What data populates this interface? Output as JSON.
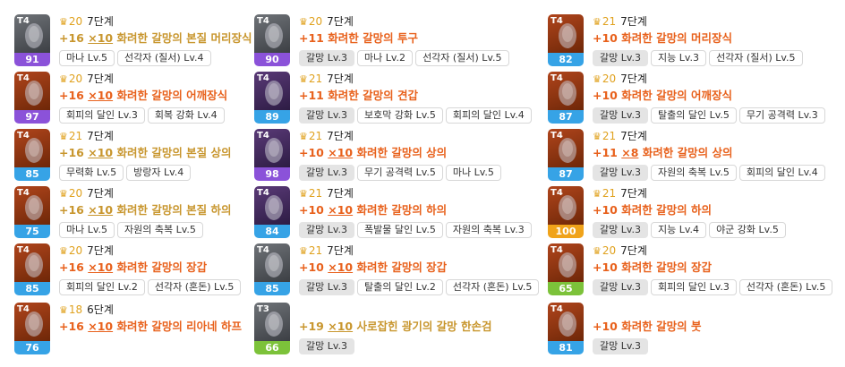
{
  "items": [
    {
      "tier": "T4",
      "level": "91",
      "quality": "20",
      "stage": "7단계",
      "plus": "+16",
      "mult": "×10",
      "name": " 화려한 갈망의 본질 머리장식",
      "badges": [
        "마나 Lv.5",
        "선각자 (질서) Lv.4"
      ]
    },
    {
      "tier": "T4",
      "level": "90",
      "quality": "20",
      "stage": "7단계",
      "plus": "+11",
      "mult": "",
      "name": " 화려한 갈망의 투구",
      "badges": [
        "갈망 Lv.3",
        "마나 Lv.2",
        "선각자 (질서) Lv.5"
      ]
    },
    {
      "tier": "T4",
      "level": "82",
      "quality": "21",
      "stage": "7단계",
      "plus": "+10",
      "mult": "",
      "name": " 화려한 갈망의 머리장식",
      "badges": [
        "갈망 Lv.3",
        "지능 Lv.3",
        "선각자 (질서) Lv.5"
      ]
    },
    {
      "tier": "T4",
      "level": "97",
      "quality": "20",
      "stage": "7단계",
      "plus": "+16",
      "mult": "×10",
      "name": " 화려한 갈망의 어깨장식",
      "badges": [
        "회피의 달인 Lv.3",
        "회복 강화 Lv.4"
      ]
    },
    {
      "tier": "T4",
      "level": "89",
      "quality": "21",
      "stage": "7단계",
      "plus": "+11",
      "mult": "",
      "name": " 화려한 갈망의 견갑",
      "badges": [
        "갈망 Lv.3",
        "보호막 강화 Lv.5",
        "회피의 달인 Lv.4"
      ]
    },
    {
      "tier": "T4",
      "level": "87",
      "quality": "20",
      "stage": "7단계",
      "plus": "+10",
      "mult": "",
      "name": " 화려한 갈망의 어깨장식",
      "badges": [
        "갈망 Lv.3",
        "탈출의 달인 Lv.5",
        "무기 공격력 Lv.3"
      ]
    },
    {
      "tier": "T4",
      "level": "85",
      "quality": "21",
      "stage": "7단계",
      "plus": "+16",
      "mult": "×10",
      "name": " 화려한 갈망의 본질 상의",
      "badges": [
        "무력화 Lv.5",
        "방랑자 Lv.4"
      ]
    },
    {
      "tier": "T4",
      "level": "98",
      "quality": "21",
      "stage": "7단계",
      "plus": "+10",
      "mult": "×10",
      "name": " 화려한 갈망의 상의",
      "badges": [
        "갈망 Lv.3",
        "무기 공격력 Lv.5",
        "마나 Lv.5"
      ]
    },
    {
      "tier": "T4",
      "level": "87",
      "quality": "21",
      "stage": "7단계",
      "plus": "+11",
      "mult": "×8",
      "name": " 화려한 갈망의 상의",
      "badges": [
        "갈망 Lv.3",
        "자원의 축복 Lv.5",
        "회피의 달인 Lv.4"
      ]
    },
    {
      "tier": "T4",
      "level": "75",
      "quality": "20",
      "stage": "7단계",
      "plus": "+16",
      "mult": "×10",
      "name": " 화려한 갈망의 본질 하의",
      "badges": [
        "마나 Lv.5",
        "자원의 축복 Lv.5"
      ]
    },
    {
      "tier": "T4",
      "level": "84",
      "quality": "21",
      "stage": "7단계",
      "plus": "+10",
      "mult": "×10",
      "name": " 화려한 갈망의 하의",
      "badges": [
        "갈망 Lv.3",
        "폭발물 달인 Lv.5",
        "자원의 축복 Lv.3"
      ]
    },
    {
      "tier": "T4",
      "level": "100",
      "quality": "21",
      "stage": "7단계",
      "plus": "+10",
      "mult": "",
      "name": " 화려한 갈망의 하의",
      "badges": [
        "갈망 Lv.3",
        "지능 Lv.4",
        "야군 강화 Lv.5"
      ]
    },
    {
      "tier": "T4",
      "level": "85",
      "quality": "20",
      "stage": "7단계",
      "plus": "+16",
      "mult": "×10",
      "name": " 화려한 갈망의 장갑",
      "badges": [
        "회피의 달인 Lv.2",
        "선각자 (혼돈) Lv.5"
      ]
    },
    {
      "tier": "T4",
      "level": "85",
      "quality": "21",
      "stage": "7단계",
      "plus": "+10",
      "mult": "×10",
      "name": " 화려한 갈망의 장갑",
      "badges": [
        "갈망 Lv.3",
        "탈출의 달인 Lv.2",
        "선각자 (혼돈) Lv.5"
      ]
    },
    {
      "tier": "T4",
      "level": "65",
      "quality": "20",
      "stage": "7단계",
      "plus": "+10",
      "mult": "",
      "name": " 화려한 갈망의 장갑",
      "badges": [
        "갈망 Lv.3",
        "회피의 달인 Lv.3",
        "선각자 (혼돈) Lv.5"
      ]
    },
    {
      "tier": "T4",
      "level": "76",
      "quality": "18",
      "stage": "6단계",
      "plus": "+16",
      "mult": "×10",
      "name": " 화려한 갈망의 리아네 하프",
      "badges": []
    },
    {
      "tier": "T3",
      "level": "66",
      "quality": "",
      "stage": "",
      "plus": "+19",
      "mult": "×10",
      "name": " 사로잡힌 광기의 갈망 한손검",
      "badges": [
        "갈망 Lv.3"
      ]
    },
    {
      "tier": "T4",
      "level": "81",
      "quality": "",
      "stage": "",
      "plus": "+10",
      "mult": "",
      "name": " 화려한 갈망의 붓",
      "badges": [
        "갈망 Lv.3"
      ]
    }
  ]
}
